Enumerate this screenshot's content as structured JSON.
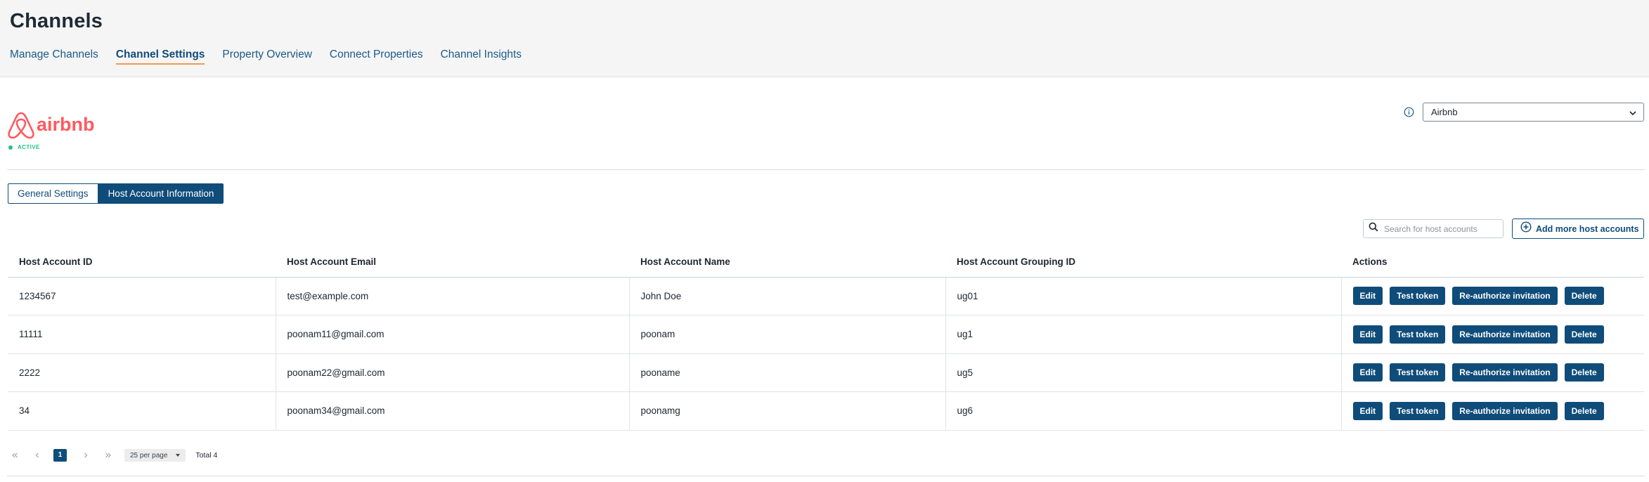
{
  "header": {
    "title": "Channels",
    "tabs": [
      {
        "label": "Manage Channels",
        "active": false
      },
      {
        "label": "Channel Settings",
        "active": true
      },
      {
        "label": "Property Overview",
        "active": false
      },
      {
        "label": "Connect Properties",
        "active": false
      },
      {
        "label": "Channel Insights",
        "active": false
      }
    ]
  },
  "channel": {
    "logo_text": "airbnb",
    "status": "ACTIVE",
    "selected": "Airbnb",
    "brand_color": "#ff5a5f",
    "status_color": "#1ec28b"
  },
  "settings_tabs": [
    {
      "label": "General Settings",
      "active": false
    },
    {
      "label": "Host Account Information",
      "active": true
    }
  ],
  "toolbar": {
    "search_placeholder": "Search for host accounts",
    "search_value": "",
    "add_label": "Add more host accounts"
  },
  "table": {
    "columns": [
      "Host Account ID",
      "Host Account Email",
      "Host Account Name",
      "Host Account Grouping ID",
      "Actions"
    ],
    "action_labels": {
      "edit": "Edit",
      "test": "Test token",
      "reauth": "Re-authorize invitation",
      "delete": "Delete"
    },
    "rows": [
      {
        "id": "1234567",
        "email": "test@example.com",
        "name": "John Doe",
        "group": "ug01"
      },
      {
        "id": "11111",
        "email": "poonam11@gmail.com",
        "name": "poonam",
        "group": "ug1"
      },
      {
        "id": "2222",
        "email": "poonam22@gmail.com",
        "name": "pooname",
        "group": "ug5"
      },
      {
        "id": "34",
        "email": "poonam34@gmail.com",
        "name": "poonamg",
        "group": "ug6"
      }
    ]
  },
  "pagination": {
    "current_page": "1",
    "per_page": "25 per page",
    "total": "Total 4"
  },
  "colors": {
    "primary": "#0f4c7a",
    "nav_link": "#1a5a8a",
    "active_underline": "#f2994a"
  },
  "icons": {
    "info": "info-icon",
    "select": "chevron-down-icon",
    "search": "search-icon",
    "add": "plus-circle-icon",
    "first": "double-chevron-left-icon",
    "prev": "chevron-left-icon",
    "next": "chevron-right-icon",
    "last": "double-chevron-right-icon"
  }
}
